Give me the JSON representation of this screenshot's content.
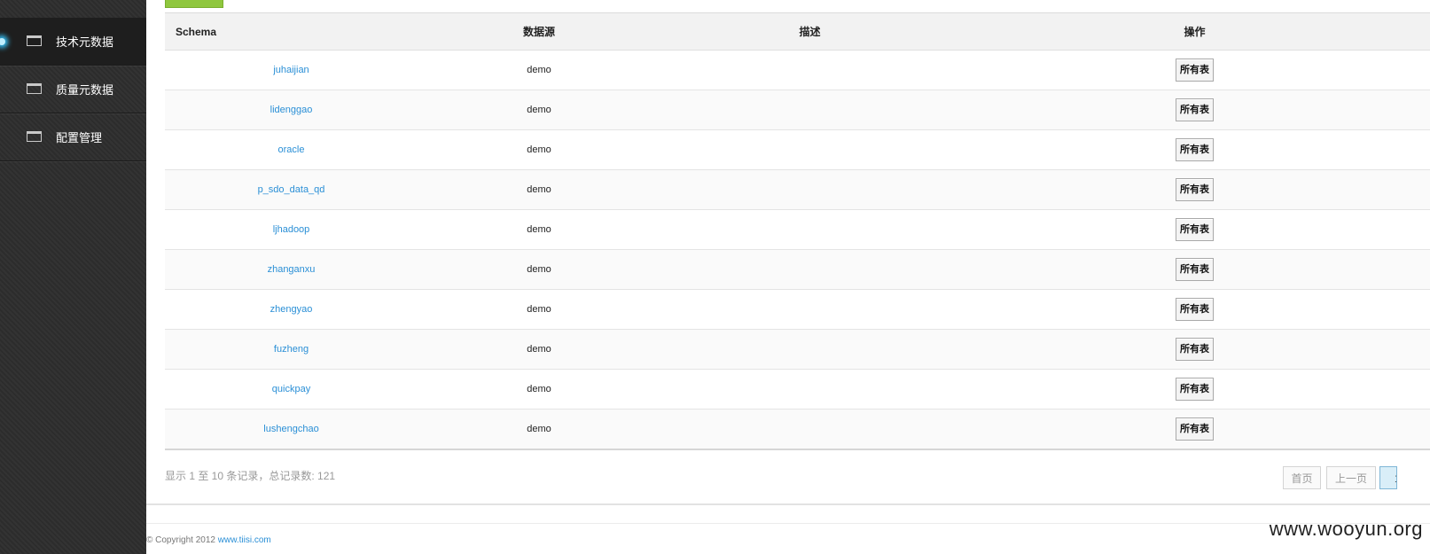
{
  "sidebar": {
    "top_partial_label": "",
    "items": [
      {
        "label": "技术元数据",
        "active": true
      },
      {
        "label": "质量元数据",
        "active": false
      },
      {
        "label": "配置管理",
        "active": false
      }
    ]
  },
  "table": {
    "headers": [
      "Schema",
      "数据源",
      "描述",
      "操作"
    ],
    "rows": [
      {
        "schema": "juhaijian",
        "source": "demo",
        "desc": "",
        "action": "所有表"
      },
      {
        "schema": "lidenggao",
        "source": "demo",
        "desc": "",
        "action": "所有表"
      },
      {
        "schema": "oracle",
        "source": "demo",
        "desc": "",
        "action": "所有表"
      },
      {
        "schema": "p_sdo_data_qd",
        "source": "demo",
        "desc": "",
        "action": "所有表"
      },
      {
        "schema": "ljhadoop",
        "source": "demo",
        "desc": "",
        "action": "所有表"
      },
      {
        "schema": "zhanganxu",
        "source": "demo",
        "desc": "",
        "action": "所有表"
      },
      {
        "schema": "zhengyao",
        "source": "demo",
        "desc": "",
        "action": "所有表"
      },
      {
        "schema": "fuzheng",
        "source": "demo",
        "desc": "",
        "action": "所有表"
      },
      {
        "schema": "quickpay",
        "source": "demo",
        "desc": "",
        "action": "所有表"
      },
      {
        "schema": "lushengchao",
        "source": "demo",
        "desc": "",
        "action": "所有表"
      }
    ]
  },
  "pagination": {
    "info": "显示 1 至 10 条记录，总记录数: 121",
    "first": "首页",
    "prev": "上一页",
    "current": "1"
  },
  "footer": {
    "copyright": "© Copyright 2012 ",
    "link": "www.tiisi.com"
  },
  "watermark": "www.wooyun.org"
}
